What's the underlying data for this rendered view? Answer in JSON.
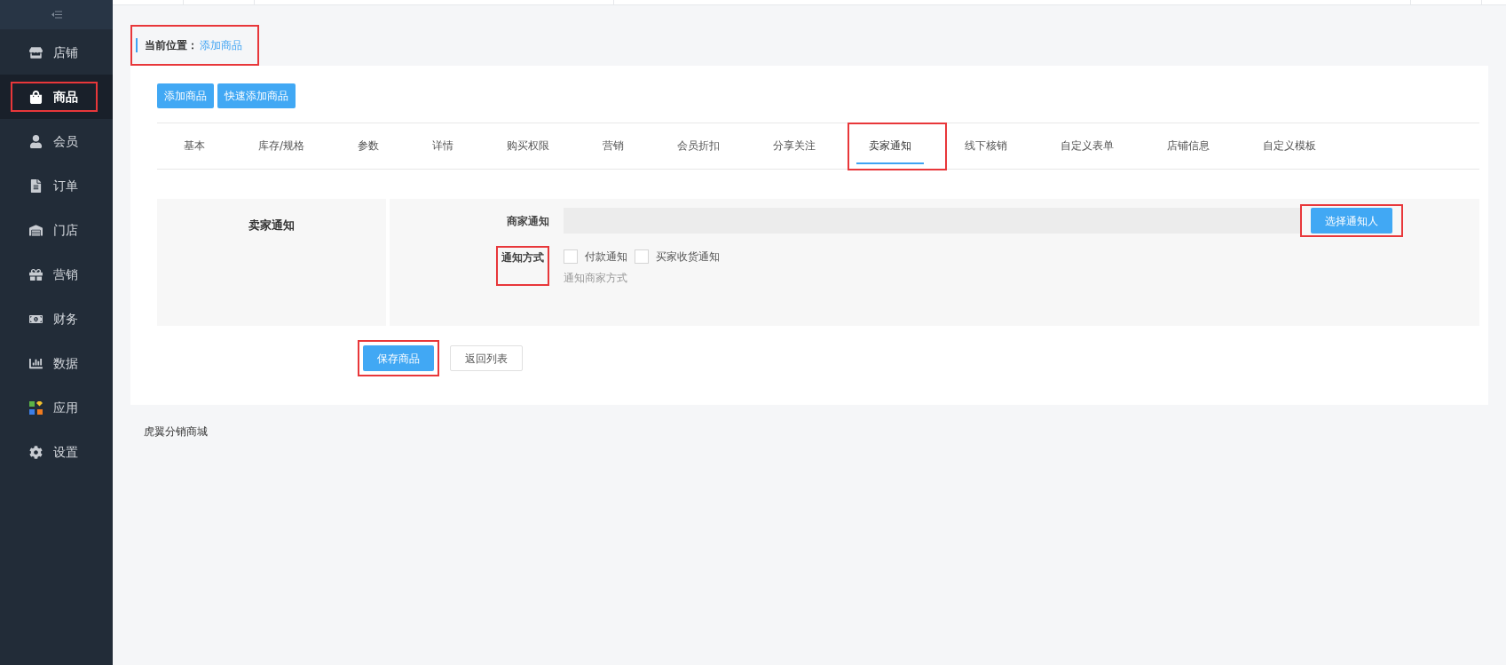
{
  "sidebar": {
    "items": [
      {
        "label": "店铺",
        "selected": false,
        "highlighted": false
      },
      {
        "label": "商品",
        "selected": true,
        "highlighted": true
      },
      {
        "label": "会员",
        "selected": false,
        "highlighted": false
      },
      {
        "label": "订单",
        "selected": false,
        "highlighted": false
      },
      {
        "label": "门店",
        "selected": false,
        "highlighted": false
      },
      {
        "label": "营销",
        "selected": false,
        "highlighted": false
      },
      {
        "label": "财务",
        "selected": false,
        "highlighted": false
      },
      {
        "label": "数据",
        "selected": false,
        "highlighted": false
      },
      {
        "label": "应用",
        "selected": false,
        "highlighted": false
      },
      {
        "label": "设置",
        "selected": false,
        "highlighted": false
      }
    ]
  },
  "breadcrumb": {
    "label": "当前位置：",
    "current": "添加商品",
    "highlighted": true
  },
  "top_buttons": [
    "添加商品",
    "快速添加商品"
  ],
  "tabs": [
    {
      "label": "基本",
      "selected": false,
      "highlighted": false
    },
    {
      "label": "库存/规格",
      "selected": false,
      "highlighted": false
    },
    {
      "label": "参数",
      "selected": false,
      "highlighted": false
    },
    {
      "label": "详情",
      "selected": false,
      "highlighted": false
    },
    {
      "label": "购买权限",
      "selected": false,
      "highlighted": false
    },
    {
      "label": "营销",
      "selected": false,
      "highlighted": false
    },
    {
      "label": "会员折扣",
      "selected": false,
      "highlighted": false
    },
    {
      "label": "分享关注",
      "selected": false,
      "highlighted": false
    },
    {
      "label": "卖家通知",
      "selected": true,
      "highlighted": true
    },
    {
      "label": "线下核销",
      "selected": false,
      "highlighted": false
    },
    {
      "label": "自定义表单",
      "selected": false,
      "highlighted": false
    },
    {
      "label": "店铺信息",
      "selected": false,
      "highlighted": false
    },
    {
      "label": "自定义模板",
      "selected": false,
      "highlighted": false
    }
  ],
  "section": {
    "title": "卖家通知",
    "merchant_notify": {
      "label": "商家通知",
      "button": "选择通知人",
      "button_highlighted": true
    },
    "notify_method": {
      "label": "通知方式",
      "label_highlighted": true,
      "options": [
        {
          "label": "付款通知",
          "checked": false
        },
        {
          "label": "买家收货通知",
          "checked": false
        }
      ],
      "hint": "通知商家方式"
    }
  },
  "actions": [
    {
      "label": "保存商品",
      "kind": "primary",
      "highlighted": true
    },
    {
      "label": "返回列表",
      "kind": "default",
      "highlighted": false
    }
  ],
  "footer": "虎翼分销商城"
}
